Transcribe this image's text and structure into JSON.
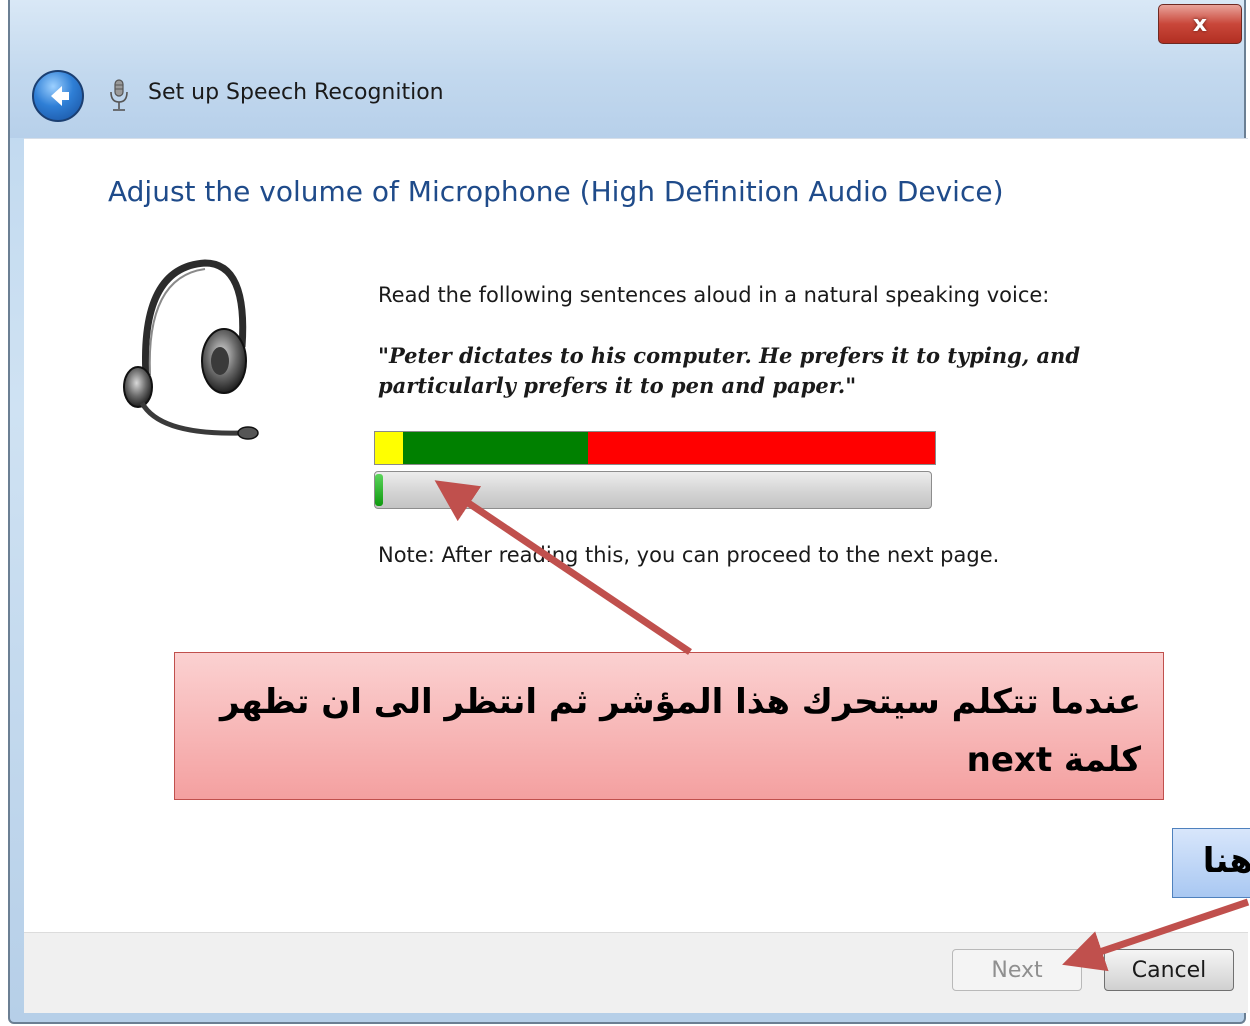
{
  "window": {
    "title": "Set up Speech Recognition",
    "close_label": "x"
  },
  "page": {
    "heading": "Adjust the volume of Microphone (High Definition Audio Device)",
    "instruction": "Read the following sentences aloud in a natural speaking voice:",
    "quote": "\"Peter dictates to his computer. He prefers it to typing, and particularly prefers it to pen and paper.\"",
    "note": "Note: After reading this, you can proceed to the next page."
  },
  "volume_meter": {
    "scale_colors": [
      "#ffff00",
      "#008000",
      "#ff0000"
    ],
    "scale_fractions": [
      0.05,
      0.33,
      0.62
    ],
    "current_level": 0.015
  },
  "buttons": {
    "next_label": "Next",
    "next_enabled": false,
    "cancel_label": "Cancel"
  },
  "annotations": {
    "callout_line1": "عندما تتكلم سيتحرك هذا المؤشر ثم انتظر الى ان تظهر",
    "callout_line2": "كلمة next",
    "callout_small": "هنا"
  }
}
